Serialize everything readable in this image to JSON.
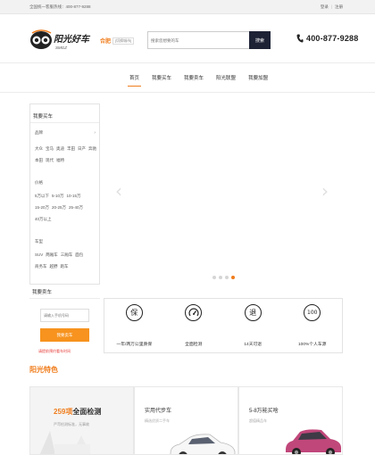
{
  "topbar": {
    "hotline": "全国统一客服热线：400-877-9288",
    "login": "登录",
    "sep": "|",
    "register": "注册"
  },
  "header": {
    "logo_text": "阳光好车",
    "logo_sub": "SMGZ",
    "city": "合肥",
    "city_switch": "[切换城市]",
    "search_placeholder": "搜索您想要的车",
    "search_button": "搜索",
    "phone": "400-877-9288"
  },
  "nav": {
    "items": [
      {
        "label": "首页",
        "active": true
      },
      {
        "label": "我要买车",
        "active": false
      },
      {
        "label": "我要卖车",
        "active": false
      },
      {
        "label": "阳光联盟",
        "active": false
      },
      {
        "label": "我要加盟",
        "active": false
      }
    ]
  },
  "filter": {
    "title": "我要买车",
    "brand_label": "品牌",
    "brands": [
      "大众",
      "宝马",
      "奥迪",
      "丰田",
      "日产",
      "奔驰",
      "本田",
      "现代",
      "福特"
    ],
    "price_label": "价格",
    "prices": [
      "5万以下",
      "5-10万",
      "10-15万",
      "15-20万",
      "20-25万",
      "25-40万",
      "40万以上"
    ],
    "type_label": "车型",
    "types": [
      "SUV",
      "两厢车",
      "三厢车",
      "面包",
      "商务车",
      "越野",
      "跑车"
    ]
  },
  "sell": {
    "title": "我要卖车",
    "phone_placeholder": "请输入手机号码",
    "button": "我要卖车",
    "note": "请提前预约看车时间"
  },
  "carousel": {
    "dot_count": 4,
    "active_dot": 3
  },
  "features": [
    {
      "icon_char": "保",
      "label": "一年/两万公里质保"
    },
    {
      "icon_char": "",
      "label": "全面检测"
    },
    {
      "icon_char": "退",
      "label": "14天可退"
    },
    {
      "icon_char": "100",
      "label": "100%个人车源"
    }
  ],
  "section": {
    "title": "阳光特色"
  },
  "cards": [
    {
      "big_number": "259项",
      "big_text": "全面检测",
      "sub": "严苛检测标准，无事故"
    },
    {
      "title": "实用代步车",
      "sub": "精选优质二手车"
    },
    {
      "title": "5-8万能买啥",
      "sub": "超值精品车"
    }
  ],
  "colors": {
    "accent": "#f07d1c",
    "button_dark": "#1d2235",
    "sell_button": "#f7931e",
    "note_red": "#e53935"
  }
}
